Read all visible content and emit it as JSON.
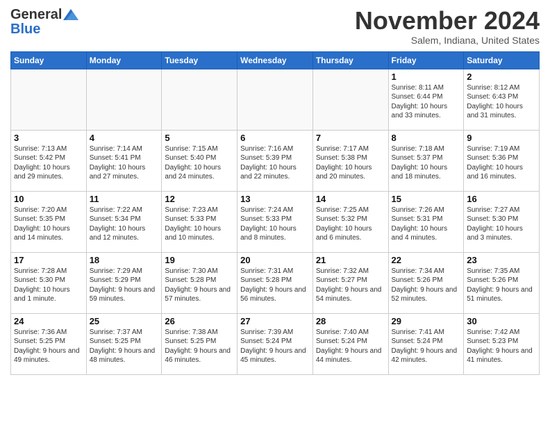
{
  "header": {
    "logo_general": "General",
    "logo_blue": "Blue",
    "month_title": "November 2024",
    "location": "Salem, Indiana, United States"
  },
  "days_of_week": [
    "Sunday",
    "Monday",
    "Tuesday",
    "Wednesday",
    "Thursday",
    "Friday",
    "Saturday"
  ],
  "weeks": [
    [
      {
        "day": "",
        "info": ""
      },
      {
        "day": "",
        "info": ""
      },
      {
        "day": "",
        "info": ""
      },
      {
        "day": "",
        "info": ""
      },
      {
        "day": "",
        "info": ""
      },
      {
        "day": "1",
        "info": "Sunrise: 8:11 AM\nSunset: 6:44 PM\nDaylight: 10 hours and 33 minutes."
      },
      {
        "day": "2",
        "info": "Sunrise: 8:12 AM\nSunset: 6:43 PM\nDaylight: 10 hours and 31 minutes."
      }
    ],
    [
      {
        "day": "3",
        "info": "Sunrise: 7:13 AM\nSunset: 5:42 PM\nDaylight: 10 hours and 29 minutes."
      },
      {
        "day": "4",
        "info": "Sunrise: 7:14 AM\nSunset: 5:41 PM\nDaylight: 10 hours and 27 minutes."
      },
      {
        "day": "5",
        "info": "Sunrise: 7:15 AM\nSunset: 5:40 PM\nDaylight: 10 hours and 24 minutes."
      },
      {
        "day": "6",
        "info": "Sunrise: 7:16 AM\nSunset: 5:39 PM\nDaylight: 10 hours and 22 minutes."
      },
      {
        "day": "7",
        "info": "Sunrise: 7:17 AM\nSunset: 5:38 PM\nDaylight: 10 hours and 20 minutes."
      },
      {
        "day": "8",
        "info": "Sunrise: 7:18 AM\nSunset: 5:37 PM\nDaylight: 10 hours and 18 minutes."
      },
      {
        "day": "9",
        "info": "Sunrise: 7:19 AM\nSunset: 5:36 PM\nDaylight: 10 hours and 16 minutes."
      }
    ],
    [
      {
        "day": "10",
        "info": "Sunrise: 7:20 AM\nSunset: 5:35 PM\nDaylight: 10 hours and 14 minutes."
      },
      {
        "day": "11",
        "info": "Sunrise: 7:22 AM\nSunset: 5:34 PM\nDaylight: 10 hours and 12 minutes."
      },
      {
        "day": "12",
        "info": "Sunrise: 7:23 AM\nSunset: 5:33 PM\nDaylight: 10 hours and 10 minutes."
      },
      {
        "day": "13",
        "info": "Sunrise: 7:24 AM\nSunset: 5:33 PM\nDaylight: 10 hours and 8 minutes."
      },
      {
        "day": "14",
        "info": "Sunrise: 7:25 AM\nSunset: 5:32 PM\nDaylight: 10 hours and 6 minutes."
      },
      {
        "day": "15",
        "info": "Sunrise: 7:26 AM\nSunset: 5:31 PM\nDaylight: 10 hours and 4 minutes."
      },
      {
        "day": "16",
        "info": "Sunrise: 7:27 AM\nSunset: 5:30 PM\nDaylight: 10 hours and 3 minutes."
      }
    ],
    [
      {
        "day": "17",
        "info": "Sunrise: 7:28 AM\nSunset: 5:30 PM\nDaylight: 10 hours and 1 minute."
      },
      {
        "day": "18",
        "info": "Sunrise: 7:29 AM\nSunset: 5:29 PM\nDaylight: 9 hours and 59 minutes."
      },
      {
        "day": "19",
        "info": "Sunrise: 7:30 AM\nSunset: 5:28 PM\nDaylight: 9 hours and 57 minutes."
      },
      {
        "day": "20",
        "info": "Sunrise: 7:31 AM\nSunset: 5:28 PM\nDaylight: 9 hours and 56 minutes."
      },
      {
        "day": "21",
        "info": "Sunrise: 7:32 AM\nSunset: 5:27 PM\nDaylight: 9 hours and 54 minutes."
      },
      {
        "day": "22",
        "info": "Sunrise: 7:34 AM\nSunset: 5:26 PM\nDaylight: 9 hours and 52 minutes."
      },
      {
        "day": "23",
        "info": "Sunrise: 7:35 AM\nSunset: 5:26 PM\nDaylight: 9 hours and 51 minutes."
      }
    ],
    [
      {
        "day": "24",
        "info": "Sunrise: 7:36 AM\nSunset: 5:25 PM\nDaylight: 9 hours and 49 minutes."
      },
      {
        "day": "25",
        "info": "Sunrise: 7:37 AM\nSunset: 5:25 PM\nDaylight: 9 hours and 48 minutes."
      },
      {
        "day": "26",
        "info": "Sunrise: 7:38 AM\nSunset: 5:25 PM\nDaylight: 9 hours and 46 minutes."
      },
      {
        "day": "27",
        "info": "Sunrise: 7:39 AM\nSunset: 5:24 PM\nDaylight: 9 hours and 45 minutes."
      },
      {
        "day": "28",
        "info": "Sunrise: 7:40 AM\nSunset: 5:24 PM\nDaylight: 9 hours and 44 minutes."
      },
      {
        "day": "29",
        "info": "Sunrise: 7:41 AM\nSunset: 5:24 PM\nDaylight: 9 hours and 42 minutes."
      },
      {
        "day": "30",
        "info": "Sunrise: 7:42 AM\nSunset: 5:23 PM\nDaylight: 9 hours and 41 minutes."
      }
    ]
  ]
}
